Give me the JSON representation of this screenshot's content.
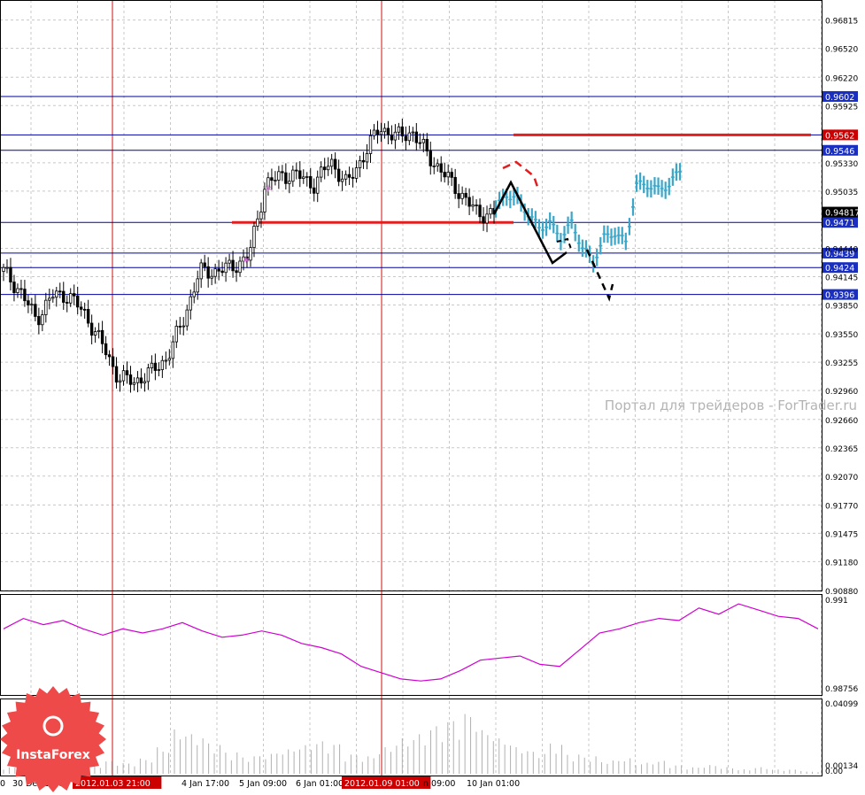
{
  "watermark": "Портал для трейдеров - ForTrader.ru",
  "logo_text": "InstaForex",
  "colors": {
    "background": "#ffffff",
    "grid": "#c8c8c8",
    "candle": "#000000",
    "forecast_bars": "#3aa6c8",
    "level_line": "#0000a0",
    "support_resistance": "#e02020",
    "vertical_marker": "#d01010",
    "oscillator": "#d000d0",
    "volume": "#b0b0b0",
    "label_bg_blue": "#1a2fc0",
    "label_bg_red": "#cc0000"
  },
  "chart_data": [
    {
      "type": "candlestick",
      "title": "",
      "ylim": [
        0.9088,
        0.9695
      ],
      "price_ticks": [
        "0.96815",
        "0.96520",
        "0.96220",
        "0.95925",
        "0.95330",
        "0.95035",
        "0.94440",
        "0.94145",
        "0.93850",
        "0.93550",
        "0.93255",
        "0.92960",
        "0.92660",
        "0.92365",
        "0.92070",
        "0.91770",
        "0.91475",
        "0.91180",
        "0.90880"
      ],
      "current_price": "0.94817",
      "x_labels": [
        "0",
        "30 Dec 14:00",
        "2012.01.03 21:00",
        "4 Jan 17:00",
        "5 Jan 09:00",
        "6 Jan 01:00",
        "2012.01.09 01:00",
        "n 09:00",
        "10 Jan 01:00"
      ],
      "highlighted_time_labels": [
        "2012.01.03 21:00",
        "2012.01.09 01:00"
      ],
      "horizontal_levels": [
        {
          "label": "0.9602",
          "value": 0.9602
        },
        {
          "label": "0.9562",
          "value": 0.9562
        },
        {
          "label": "0.9546",
          "value": 0.9546
        },
        {
          "label": "0.9471",
          "value": 0.9471
        },
        {
          "label": "0.9439",
          "value": 0.9439
        },
        {
          "label": "0.9424",
          "value": 0.9424
        },
        {
          "label": "0.9396",
          "value": 0.9396
        }
      ],
      "highlighted_level_labels": [
        "0.9562"
      ],
      "red_segments": [
        {
          "from": "5 Jan",
          "to": "10 Jan",
          "value": 0.9471
        },
        {
          "from": "forecast start",
          "to": "chart end",
          "value": 0.9562
        }
      ],
      "closes_approx": [
        0.942,
        0.94,
        0.937,
        0.9395,
        0.9395,
        0.9375,
        0.9345,
        0.931,
        0.9305,
        0.9315,
        0.933,
        0.937,
        0.942,
        0.942,
        0.9425,
        0.9435,
        0.951,
        0.952,
        0.952,
        0.951,
        0.9535,
        0.951,
        0.954,
        0.957,
        0.956,
        0.9565,
        0.954,
        0.952,
        0.95,
        0.948,
        0.948
      ],
      "forecast_closes_approx": [
        0.9485,
        0.95,
        0.9495,
        0.948,
        0.9465,
        0.947,
        0.9455,
        0.947,
        0.9445,
        0.943,
        0.9455,
        0.946,
        0.945,
        0.951,
        0.951,
        0.9505,
        0.951,
        0.9525
      ]
    },
    {
      "type": "line",
      "title": "",
      "y_ticks": [
        "0.991",
        "0.98756"
      ],
      "series": [
        {
          "values": [
            0.99,
            0.9905,
            0.9902,
            0.9904,
            0.99,
            0.9897,
            0.99,
            0.9898,
            0.99,
            0.9903,
            0.9899,
            0.9896,
            0.9897,
            0.9899,
            0.9897,
            0.9893,
            0.9891,
            0.9888,
            0.9882,
            0.9879,
            0.9876,
            0.9875,
            0.9876,
            0.988,
            0.9885,
            0.9886,
            0.9887,
            0.9883,
            0.9882,
            0.989,
            0.9898,
            0.99,
            0.9903,
            0.9905,
            0.9904,
            0.991,
            0.9907,
            0.9912,
            0.9909,
            0.9906,
            0.9905,
            0.99
          ]
        }
      ]
    },
    {
      "type": "bar",
      "title": "",
      "y_ticks": [
        "0.04099",
        "0.00134",
        "0.00"
      ],
      "values": [
        3,
        2,
        4,
        3,
        5,
        4,
        6,
        5,
        7,
        12,
        20,
        18,
        14,
        10,
        8,
        9,
        11,
        13,
        15,
        14,
        9,
        8,
        12,
        16,
        18,
        22,
        25,
        28,
        20,
        16,
        12,
        10,
        14,
        9,
        8,
        6,
        7,
        5,
        6,
        4,
        3,
        4,
        3,
        2,
        3,
        2,
        2,
        1
      ]
    }
  ]
}
